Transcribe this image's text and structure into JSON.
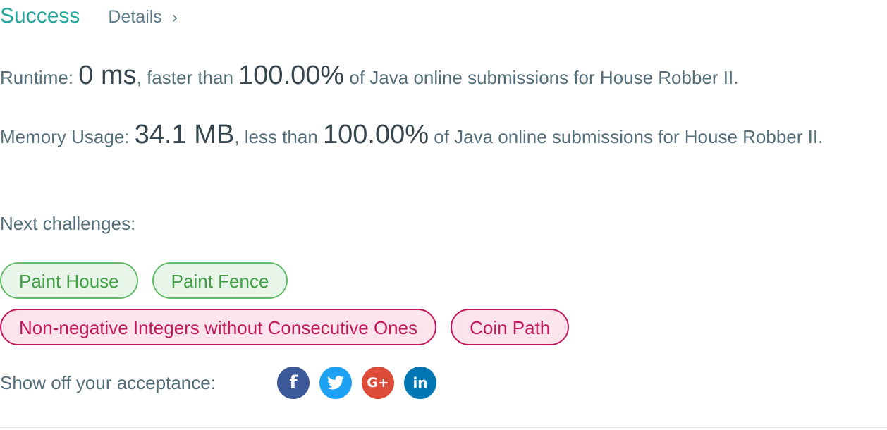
{
  "header": {
    "status": "Success",
    "details_label": "Details",
    "chevron": "›"
  },
  "runtime": {
    "label": "Runtime: ",
    "value": "0 ms",
    "mid": ", faster than ",
    "percent": "100.00%",
    "tail": " of Java online submissions for House Robber II."
  },
  "memory": {
    "label": "Memory Usage: ",
    "value": "34.1 MB",
    "mid": ", less than ",
    "percent": "100.00%",
    "tail": " of Java online submissions for House Robber II."
  },
  "next": {
    "label": "Next challenges:",
    "challenges": [
      {
        "label": "Paint House",
        "difficulty": "easy"
      },
      {
        "label": "Paint Fence",
        "difficulty": "easy"
      },
      {
        "label": "Non-negative Integers without Consecutive Ones",
        "difficulty": "hard"
      },
      {
        "label": "Coin Path",
        "difficulty": "hard"
      }
    ]
  },
  "share": {
    "label": "Show off your acceptance:",
    "icons": [
      {
        "name": "facebook-icon",
        "glyph": "f"
      },
      {
        "name": "twitter-icon",
        "glyph": ""
      },
      {
        "name": "google-plus-icon",
        "glyph": "G+"
      },
      {
        "name": "linkedin-icon",
        "glyph": "in"
      }
    ]
  },
  "colors": {
    "success": "#26a69a",
    "easy": "#43a047",
    "hard": "#c2185b"
  }
}
